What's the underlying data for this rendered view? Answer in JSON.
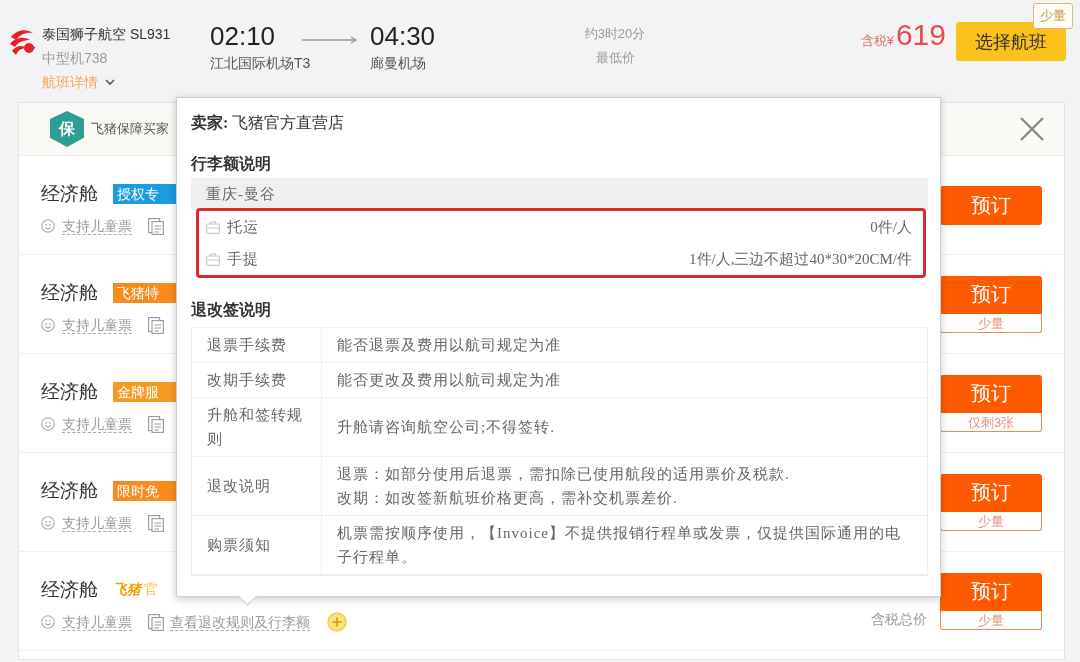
{
  "flight": {
    "airline": "泰国狮子航空 SL931",
    "aircraft": "中型机738",
    "details_link": "航班详情",
    "departure": {
      "time": "02:10",
      "airport": "江北国际机场T3"
    },
    "arrival": {
      "time": "04:30",
      "airport": "廊曼机场"
    },
    "duration": "约3时20分",
    "price_label": "最低价",
    "tax_label": "含税¥",
    "price": "619",
    "select_button": "选择航班",
    "stock_badge": "少量"
  },
  "fare_panel": {
    "guarantee_badge": "保",
    "guarantee_text": "飞猪保障买家",
    "fares": [
      {
        "cabin": "经济舱",
        "tag": {
          "kind": "label",
          "text": "授权专",
          "color": "#1b9be0"
        },
        "child_ticket": "支持儿童票",
        "book_button": "预订"
      },
      {
        "cabin": "经济舱",
        "tag": {
          "kind": "label",
          "text": "飞猪特",
          "color": "#fa8a1c"
        },
        "child_ticket": "支持儿童票",
        "book_button": "预订",
        "stock_note": "少量"
      },
      {
        "cabin": "经济舱",
        "tag": {
          "kind": "label",
          "text": "金牌服",
          "color": "#f59a24"
        },
        "child_ticket": "支持儿童票",
        "book_button": "预订",
        "stock_note": "仅剩3张"
      },
      {
        "cabin": "经济舱",
        "tag": {
          "kind": "label",
          "text": "限时免",
          "color": "#fb8b1e"
        },
        "child_ticket": "支持儿童票",
        "book_button": "预订",
        "stock_note": "少量"
      },
      {
        "cabin": "经济舱",
        "tag": {
          "kind": "brand",
          "logo": "飞猪",
          "text": "官"
        },
        "child_ticket": "支持儿童票",
        "rules_link": "查看退改规则及行李额",
        "addon_icon": true,
        "price_note": "含税总价",
        "book_button": "预订",
        "stock_note": "少量"
      }
    ]
  },
  "popup": {
    "seller": "**卖家:** 飞猪官方直营店",
    "baggage_title": "行李额说明",
    "baggage": {
      "route": "重庆-曼谷",
      "highlighted": true,
      "items": [
        {
          "type": "托运",
          "allowance": "0件/人"
        },
        {
          "type": "手提",
          "allowance": "1件/人,三边不超过40*30*20CM/件"
        }
      ]
    },
    "rules_title": "退改签说明",
    "rules": [
      {
        "label": "退票手续费",
        "lines": [
          "能否退票及费用以航司规定为准"
        ]
      },
      {
        "label": "改期手续费",
        "lines": [
          "能否更改及费用以航司规定为准"
        ]
      },
      {
        "label": "升舱和签转规则",
        "lines": [
          "升舱请咨询航空公司;不得签转."
        ]
      },
      {
        "label": "退改说明",
        "lines": [
          "退票：如部分使用后退票，需扣除已使用航段的适用票价及税款.",
          "改期：如改签新航班价格更高，需补交机票差价."
        ]
      },
      {
        "label": "购票须知",
        "lines": [
          "机票需按顺序使用，【Invoice】不提供报销行程单或发票，仅提供国际通用的电子行程单。"
        ]
      }
    ]
  }
}
